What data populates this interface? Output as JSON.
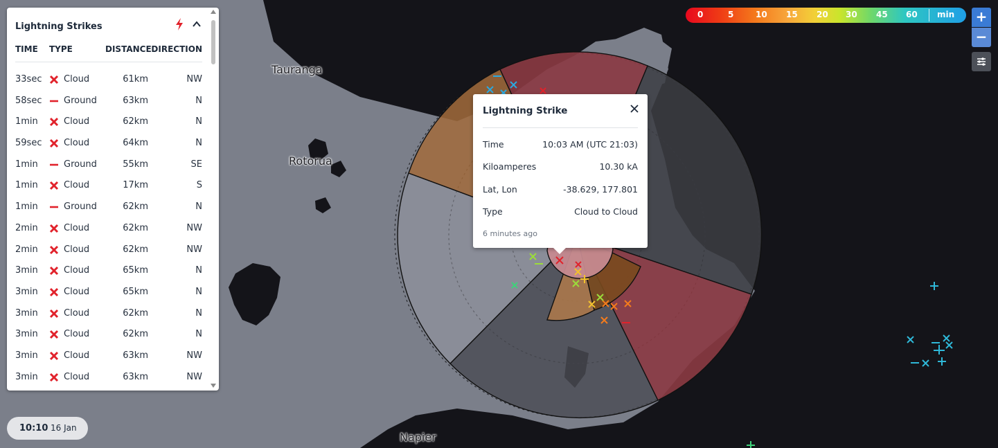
{
  "map": {
    "cities": [
      "Tauranga",
      "Rotorua",
      "Napier"
    ]
  },
  "strike_list": {
    "title": "Lightning Strikes",
    "columns": {
      "time": "TIME",
      "type": "TYPE",
      "distance": "DISTANCE",
      "direction": "DIRECTION"
    },
    "rows": [
      {
        "time": "33sec",
        "kind": "cloud",
        "type": "Cloud",
        "distance": "61km",
        "direction": "NW"
      },
      {
        "time": "58sec",
        "kind": "ground",
        "type": "Ground",
        "distance": "63km",
        "direction": "N"
      },
      {
        "time": "1min",
        "kind": "cloud",
        "type": "Cloud",
        "distance": "62km",
        "direction": "N"
      },
      {
        "time": "59sec",
        "kind": "cloud",
        "type": "Cloud",
        "distance": "64km",
        "direction": "N"
      },
      {
        "time": "1min",
        "kind": "ground",
        "type": "Ground",
        "distance": "55km",
        "direction": "SE"
      },
      {
        "time": "1min",
        "kind": "cloud",
        "type": "Cloud",
        "distance": "17km",
        "direction": "S"
      },
      {
        "time": "1min",
        "kind": "ground",
        "type": "Ground",
        "distance": "62km",
        "direction": "N"
      },
      {
        "time": "2min",
        "kind": "cloud",
        "type": "Cloud",
        "distance": "62km",
        "direction": "NW"
      },
      {
        "time": "2min",
        "kind": "cloud",
        "type": "Cloud",
        "distance": "62km",
        "direction": "NW"
      },
      {
        "time": "3min",
        "kind": "cloud",
        "type": "Cloud",
        "distance": "65km",
        "direction": "N"
      },
      {
        "time": "3min",
        "kind": "cloud",
        "type": "Cloud",
        "distance": "65km",
        "direction": "N"
      },
      {
        "time": "3min",
        "kind": "cloud",
        "type": "Cloud",
        "distance": "62km",
        "direction": "N"
      },
      {
        "time": "3min",
        "kind": "cloud",
        "type": "Cloud",
        "distance": "62km",
        "direction": "N"
      },
      {
        "time": "3min",
        "kind": "cloud",
        "type": "Cloud",
        "distance": "63km",
        "direction": "NW"
      },
      {
        "time": "3min",
        "kind": "cloud",
        "type": "Cloud",
        "distance": "63km",
        "direction": "NW"
      }
    ],
    "icons": {
      "header": "lightning-bolt-icon",
      "collapse": "chevron-up-icon",
      "cloud": "x-mark-icon",
      "ground": "minus-icon"
    }
  },
  "legend": {
    "labels": [
      "0",
      "5",
      "10",
      "15",
      "20",
      "30",
      "45",
      "60"
    ],
    "unit": "min",
    "colors": [
      "#e8081e",
      "#ef3a15",
      "#f47a1c",
      "#f7a53a",
      "#f2d037",
      "#c9e52c",
      "#6fd86a",
      "#2ec7c1",
      "#1f9fe6"
    ]
  },
  "controls": {
    "zoom_in": "+",
    "zoom_out": "−",
    "settings_icon": "sliders-icon"
  },
  "popup": {
    "title": "Lightning Strike",
    "fields": [
      {
        "key": "Time",
        "value": "10:03 AM (UTC 21:03)"
      },
      {
        "key": "Kiloamperes",
        "value": "10.30 kA"
      },
      {
        "key": "Lat, Lon",
        "value": "-38.629, 177.801"
      },
      {
        "key": "Type",
        "value": "Cloud to Cloud"
      }
    ],
    "ago": "6 minutes ago",
    "close_icon": "close-icon"
  },
  "time_pill": {
    "time": "10:10",
    "date": "16 Jan"
  },
  "colors": {
    "cloud_strike": "#e1222b",
    "ground_strike": "#e1222b",
    "panel_text": "#1e2a3a",
    "land": "#7b7f8a",
    "sea": "#141419"
  }
}
